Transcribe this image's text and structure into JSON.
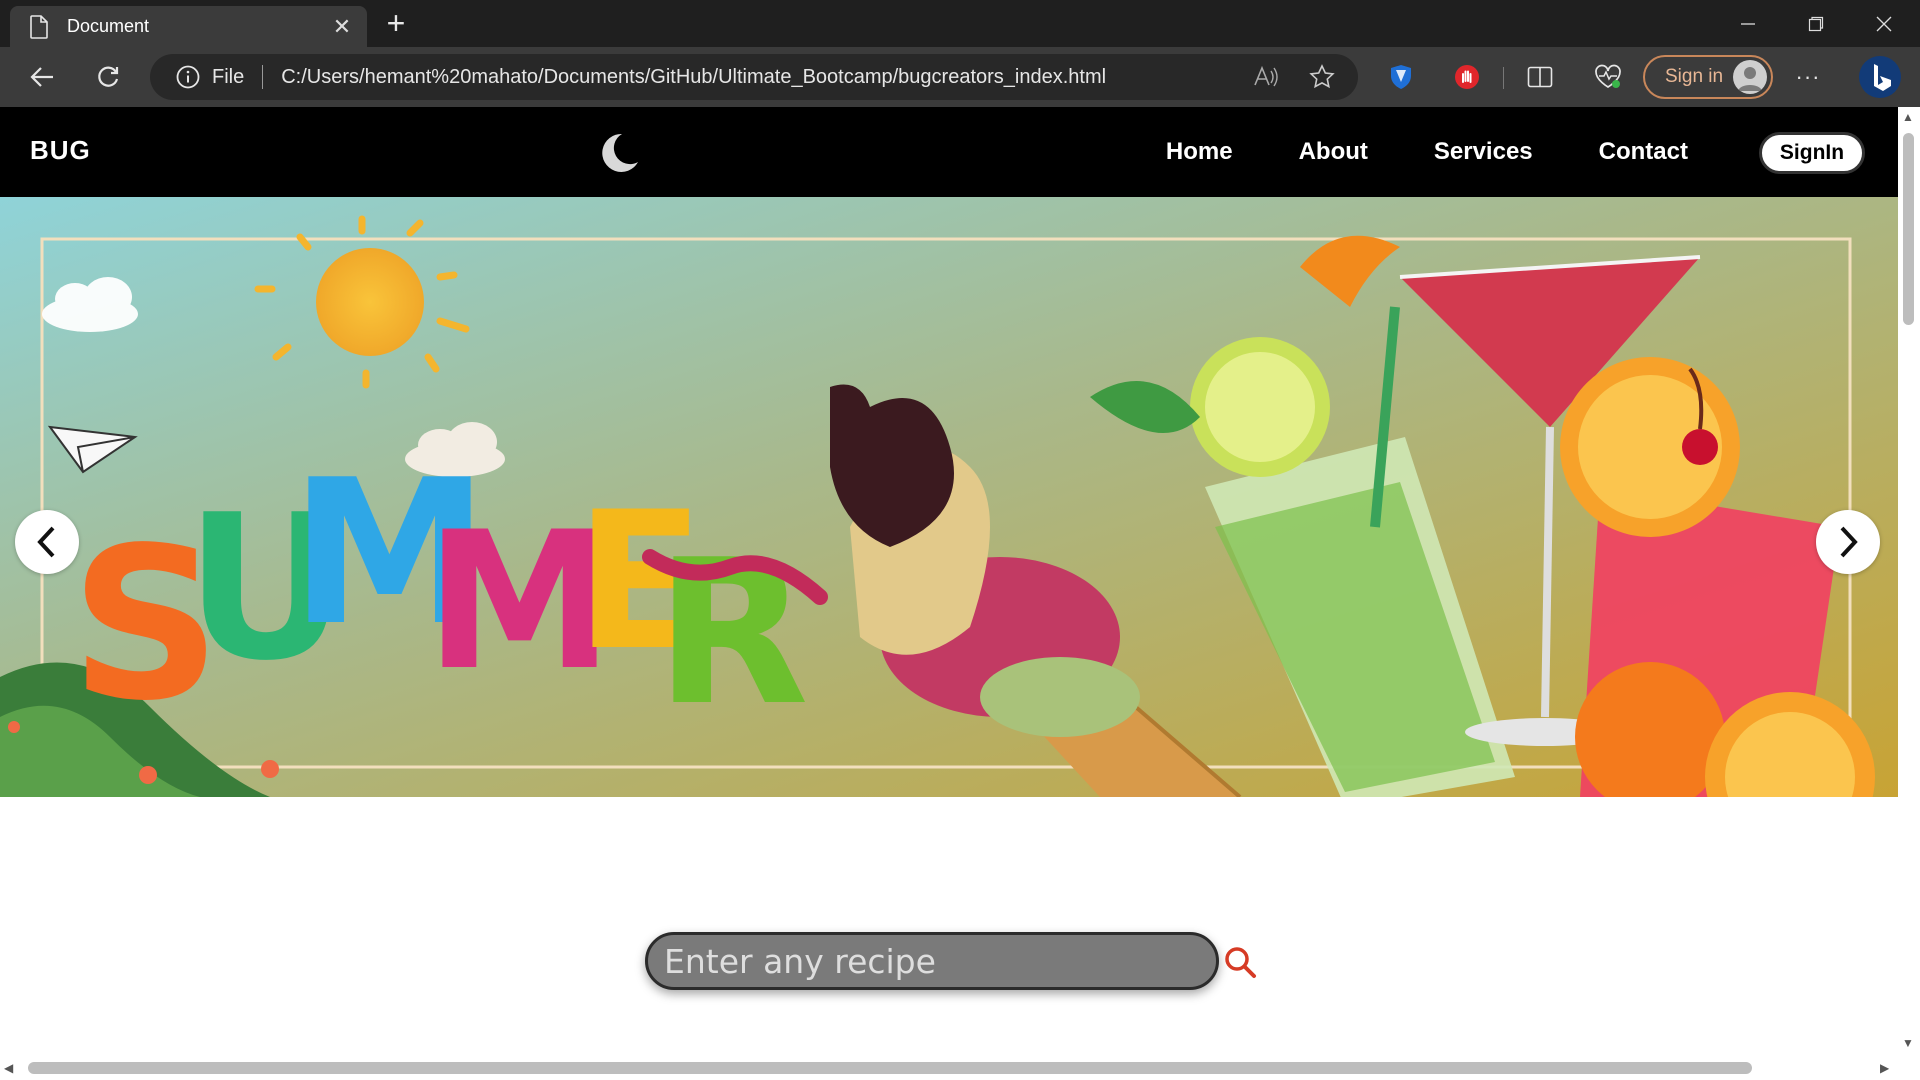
{
  "browser": {
    "tab_title": "Document",
    "address_prefix": "File",
    "url": "C:/Users/hemant%20mahato/Documents/GitHub/Ultimate_Bootcamp/bugcreators_index.html",
    "signin_label": "Sign in"
  },
  "nav": {
    "brand": "BUG",
    "links": [
      "Home",
      "About",
      "Services",
      "Contact"
    ],
    "signin_label": "SignIn"
  },
  "hero": {
    "banner_text": "SUMMER",
    "banner_letter_colors": [
      "#f36b21",
      "#2bb673",
      "#2fa7e6",
      "#d8317e",
      "#f4b81b",
      "#6dbf2e"
    ]
  },
  "search": {
    "placeholder": "Enter any recipe"
  },
  "colors": {
    "search_icon": "#d63b25",
    "nav_bg": "#000000",
    "address_bg": "#282828"
  }
}
